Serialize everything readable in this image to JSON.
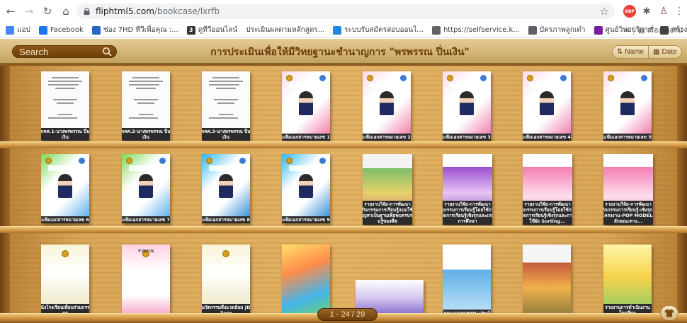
{
  "browser": {
    "url_host": "fliphtml5.com",
    "url_path": "/bookcase/lxrfb",
    "icons": [
      "back-icon",
      "forward-icon",
      "reload-icon",
      "home-icon",
      "lock-icon",
      "star-icon",
      "adblock-icon",
      "puzzle-icon",
      "profile-icon",
      "menu-icon"
    ],
    "adblock_label": "ABP"
  },
  "bookmarks": {
    "items": [
      {
        "label": "แอป",
        "icon": "apps-grid-icon",
        "color": "#4285f4"
      },
      {
        "label": "Facebook",
        "icon": "facebook-icon",
        "color": "#1877f2"
      },
      {
        "label": "ช่อง 7HD ทีวีเพื่อคุณ :...",
        "icon": "ch7-icon",
        "color": "#2a64c5"
      },
      {
        "label": "ดูทีวีออนไลน์",
        "icon": "tv-icon",
        "color": "#333333",
        "glyph": "3"
      },
      {
        "label": "ประเมินผลตามหลักสูตร...",
        "icon": "",
        "color": ""
      },
      {
        "label": "ระบบรับสมัครสอบออนไ...",
        "icon": "flag-icon",
        "color": "#1e88e5"
      },
      {
        "label": "https://selfservice.k...",
        "icon": "globe-icon",
        "color": "#5f6368"
      },
      {
        "label": "บัตรภาพลูกเต๋า",
        "icon": "globe-icon",
        "color": "#5f6368"
      },
      {
        "label": "ศูนย์วิทยบริการ",
        "icon": "circle-icon",
        "color": "#7b1fa2"
      },
      {
        "label": "สร้าง QR Code ฟรี ไม่...",
        "icon": "qr-icon",
        "color": "#444444"
      }
    ],
    "overflow": "»",
    "reading_list": "เรื่องรออ่าน"
  },
  "bookcase": {
    "search_label": "Search",
    "title": "การประเมินเพื่อให้มีวิทยฐานะชำนาญการ \"พรพรรณ ปิ่นเงิน\"",
    "sort_name": "Name",
    "sort_date": "Date",
    "pager": "1 - 24 / 29",
    "shelves": [
      {
        "books": [
          {
            "title": "กคศ.1-นางพรพรรณ ปิ่นเงิน",
            "cover": "plain"
          },
          {
            "title": "กคศ.2-นางพรพรรณ ปิ่นเงิน",
            "cover": "plain"
          },
          {
            "title": "กคศ.3-นางพรพรรณ ปิ่นเงิน",
            "cover": "plain"
          },
          {
            "title": "แฟ้มเอกสารหมายเลข 1",
            "cover": "pink"
          },
          {
            "title": "แฟ้มเอกสารหมายเลข 2",
            "cover": "pink"
          },
          {
            "title": "แฟ้มเอกสารหมายเลข 3",
            "cover": "pink"
          },
          {
            "title": "แฟ้มเอกสารหมายเลข 4",
            "cover": "pink"
          },
          {
            "title": "แฟ้มเอกสารหมายเลข 5",
            "cover": "pink"
          }
        ]
      },
      {
        "books": [
          {
            "title": "แฟ้มเอกสารหมายเลข 6",
            "cover": "green"
          },
          {
            "title": "แฟ้มเอกสารหมายเลข 7",
            "cover": "green"
          },
          {
            "title": "แฟ้มเอกสารหมายเลข 8",
            "cover": "blue"
          },
          {
            "title": "แฟ้มเอกสารหมายเลข 9",
            "cover": "blue"
          },
          {
            "title": "รายงานวิจัย-การพัฒนากิจกรรมการเรียนรู้แบบใช้ปัญหาเป็นฐานเพื่อพบครบรกนรู้ของพืช",
            "cover": "photo"
          },
          {
            "title": "รายงานวิจัย-การพัฒนากิจกรรมการเรียนรู้โดยใช้การจัดการเรียนรู้เชิงรุกและเกมการศึกษา",
            "cover": "purple"
          },
          {
            "title": "รายงานวิจัย-การพัฒนากิจกรรมการเรียนรู้โดยใช้การจัดการเรียนรู้เชิงรุกและการใช้ผัง Sorting...",
            "cover": "pinkphoto"
          },
          {
            "title": "รายงานวิจัย-การพัฒนากิจกรรมการเรียนรู้-เชิงรุก-โครงงาน-POP MODEL-ลักษณะทาง...",
            "cover": "pinkphoto"
          }
        ]
      },
      {
        "books": [
          {
            "title": "หนังโรงเรียนเพื่อนร่วมกรรม ครู",
            "cover": "thai"
          },
          {
            "title": "รายงาน",
            "cover": "report"
          },
          {
            "title": "นวัตกรรมสิ่งแวดล้อม JD Zero",
            "cover": "thai"
          },
          {
            "title": "",
            "cover": "colorful"
          },
          {
            "title": "",
            "cover": "landscape"
          },
          {
            "title": "โครงงานคุณธรรม ประจำ",
            "cover": "blue2"
          },
          {
            "title": "",
            "cover": "photo2"
          },
          {
            "title": "รายงานการดำเนินงานโรงเรียน",
            "cover": "yellow"
          }
        ]
      }
    ]
  }
}
